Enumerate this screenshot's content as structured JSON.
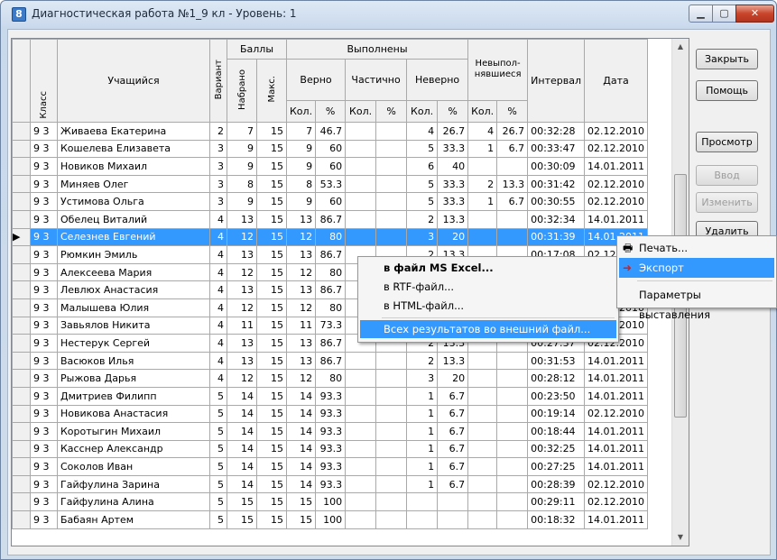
{
  "window": {
    "title": "Диагностическая работа №1_9 кл - Уровень: 1",
    "icon": "app-icon"
  },
  "headers": {
    "klass": "Класс",
    "student": "Учащийся",
    "variant": "Вариант",
    "scores_group": "Баллы",
    "scores_got": "Набрано",
    "scores_max": "Макс.",
    "done_group": "Выполнены",
    "correct": "Верно",
    "partial": "Частично",
    "wrong": "Неверно",
    "notdone": "Невыпол-нявшиеся",
    "interval": "Интервал",
    "date": "Дата",
    "count": "Кол.",
    "percent": "%"
  },
  "rows": [
    [
      "9 3",
      "Живаева Екатерина",
      "2",
      "7",
      "15",
      "7",
      "46.7",
      "",
      "",
      "4",
      "26.7",
      "4",
      "26.7",
      "00:32:28",
      "02.12.2010"
    ],
    [
      "9 3",
      "Кошелева Елизавета",
      "3",
      "9",
      "15",
      "9",
      "60",
      "",
      "",
      "5",
      "33.3",
      "1",
      "6.7",
      "00:33:47",
      "02.12.2010"
    ],
    [
      "9 3",
      "Новиков Михаил",
      "3",
      "9",
      "15",
      "9",
      "60",
      "",
      "",
      "6",
      "40",
      "",
      "",
      "00:30:09",
      "14.01.2011"
    ],
    [
      "9 3",
      "Миняев Олег",
      "3",
      "8",
      "15",
      "8",
      "53.3",
      "",
      "",
      "5",
      "33.3",
      "2",
      "13.3",
      "00:31:42",
      "02.12.2010"
    ],
    [
      "9 3",
      "Устимова Ольга",
      "3",
      "9",
      "15",
      "9",
      "60",
      "",
      "",
      "5",
      "33.3",
      "1",
      "6.7",
      "00:30:55",
      "02.12.2010"
    ],
    [
      "9 3",
      "Обелец Виталий",
      "4",
      "13",
      "15",
      "13",
      "86.7",
      "",
      "",
      "2",
      "13.3",
      "",
      "",
      "00:32:34",
      "14.01.2011"
    ],
    [
      "9 3",
      "Селезнев Евгений",
      "4",
      "12",
      "15",
      "12",
      "80",
      "",
      "",
      "3",
      "20",
      "",
      "",
      "00:31:39",
      "14.01.2011"
    ],
    [
      "9 3",
      "Рюмкин Эмиль",
      "4",
      "13",
      "15",
      "13",
      "86.7",
      "",
      "",
      "2",
      "13.3",
      "",
      "",
      "00:17:08",
      "02.12.2010"
    ],
    [
      "9 3",
      "Алексеева Мария",
      "4",
      "12",
      "15",
      "12",
      "80",
      "",
      "",
      "3",
      "20",
      "",
      "",
      "",
      "02.12.2010"
    ],
    [
      "9 3",
      "Левлюх Анастасия",
      "4",
      "13",
      "15",
      "13",
      "86.7",
      "",
      "",
      "",
      "",
      "",
      "",
      "",
      "02.12.2010"
    ],
    [
      "9 3",
      "Малышева Юлия",
      "4",
      "12",
      "15",
      "12",
      "80",
      "",
      "",
      "",
      "",
      "",
      "",
      "",
      "02.12.2010"
    ],
    [
      "9 3",
      "Завьялов Никита",
      "4",
      "11",
      "15",
      "11",
      "73.3",
      "",
      "",
      "",
      "",
      "",
      "",
      "",
      "02.12.2010"
    ],
    [
      "9 3",
      "Нестерук Сергей",
      "4",
      "13",
      "15",
      "13",
      "86.7",
      "",
      "",
      "2",
      "13.3",
      "",
      "",
      "00:27:37",
      "02.12.2010"
    ],
    [
      "9 3",
      "Васюков Илья",
      "4",
      "13",
      "15",
      "13",
      "86.7",
      "",
      "",
      "2",
      "13.3",
      "",
      "",
      "00:31:53",
      "14.01.2011"
    ],
    [
      "9 3",
      "Рыжова Дарья",
      "4",
      "12",
      "15",
      "12",
      "80",
      "",
      "",
      "3",
      "20",
      "",
      "",
      "00:28:12",
      "14.01.2011"
    ],
    [
      "9 3",
      "Дмитриев Филипп",
      "5",
      "14",
      "15",
      "14",
      "93.3",
      "",
      "",
      "1",
      "6.7",
      "",
      "",
      "00:23:50",
      "14.01.2011"
    ],
    [
      "9 3",
      "Новикова Анастасия",
      "5",
      "14",
      "15",
      "14",
      "93.3",
      "",
      "",
      "1",
      "6.7",
      "",
      "",
      "00:19:14",
      "02.12.2010"
    ],
    [
      "9 3",
      "Коротыгин Михаил",
      "5",
      "14",
      "15",
      "14",
      "93.3",
      "",
      "",
      "1",
      "6.7",
      "",
      "",
      "00:18:44",
      "14.01.2011"
    ],
    [
      "9 3",
      "Касснер Александр",
      "5",
      "14",
      "15",
      "14",
      "93.3",
      "",
      "",
      "1",
      "6.7",
      "",
      "",
      "00:32:25",
      "14.01.2011"
    ],
    [
      "9 3",
      "Соколов Иван",
      "5",
      "14",
      "15",
      "14",
      "93.3",
      "",
      "",
      "1",
      "6.7",
      "",
      "",
      "00:27:25",
      "14.01.2011"
    ],
    [
      "9 3",
      "Гайфулина Зарина",
      "5",
      "14",
      "15",
      "14",
      "93.3",
      "",
      "",
      "1",
      "6.7",
      "",
      "",
      "00:28:39",
      "02.12.2010"
    ],
    [
      "9 3",
      "Гайфулина Алина",
      "5",
      "15",
      "15",
      "15",
      "100",
      "",
      "",
      "",
      "",
      "",
      "",
      "00:29:11",
      "02.12.2010"
    ],
    [
      "9 3",
      "Бабаян Артем",
      "5",
      "15",
      "15",
      "15",
      "100",
      "",
      "",
      "",
      "",
      "",
      "",
      "00:18:32",
      "14.01.2011"
    ]
  ],
  "selected_row": 6,
  "buttons": {
    "close": "Закрыть",
    "help": "Помощь",
    "view": "Просмотр",
    "input": "Ввод",
    "edit": "Изменить",
    "delete": "Удалить"
  },
  "context_menu": {
    "print": "Печать...",
    "export": "Экспорт",
    "params": "Параметры выставления"
  },
  "submenu": {
    "excel": "в файл MS Excel...",
    "rtf": "в RTF-файл...",
    "html": "в HTML-файл...",
    "all": "Всех результатов во внешний файл..."
  }
}
